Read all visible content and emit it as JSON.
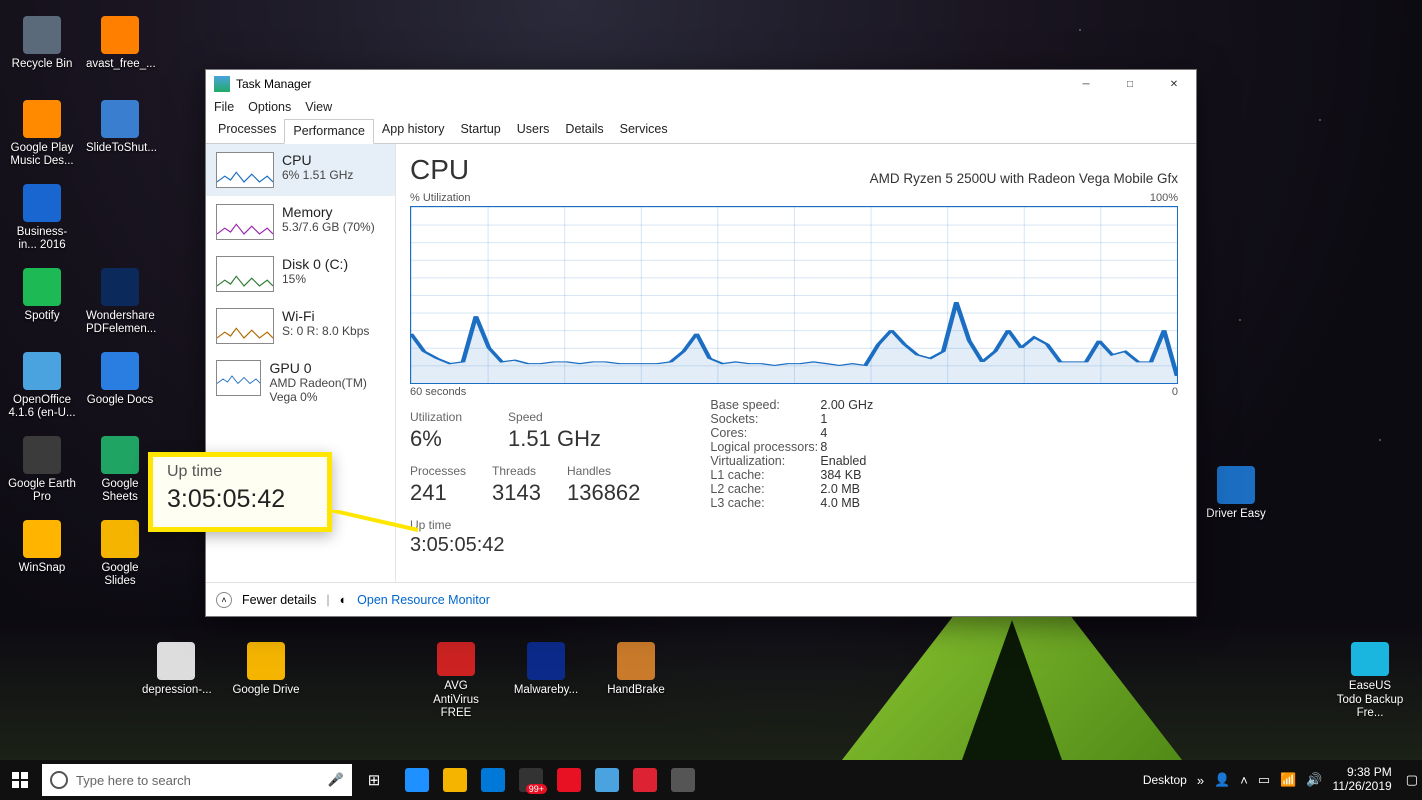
{
  "desktop": {
    "left_cols": [
      [
        {
          "label": "Recycle Bin",
          "color": "#5a6a7a"
        },
        {
          "label": "Google Play Music Des...",
          "color": "#ff8a00"
        },
        {
          "label": "Business-in... 2016",
          "color": "#1a66d0"
        },
        {
          "label": "Spotify",
          "color": "#1db954"
        },
        {
          "label": "OpenOffice 4.1.6 (en-U...",
          "color": "#4aa3df"
        },
        {
          "label": "Google Earth Pro",
          "color": "#3b3b3b"
        },
        {
          "label": "WinSnap",
          "color": "#ffb400"
        }
      ],
      [
        {
          "label": "avast_free_...",
          "color": "#ff7f00"
        },
        {
          "label": "SlideToShut...",
          "color": "#3a7ed0"
        },
        {
          "label": "",
          "color": "transparent"
        },
        {
          "label": "Wondershare PDFelemen...",
          "color": "#0b2a5b"
        },
        {
          "label": "Google Docs",
          "color": "#2a7de1"
        },
        {
          "label": "Google Sheets",
          "color": "#1fa463"
        },
        {
          "label": "Google Slides",
          "color": "#f4b400"
        }
      ]
    ],
    "right_single": {
      "label": "Driver Easy",
      "color": "#1b6ec2"
    },
    "bottom_left": [
      {
        "label": "depression-...",
        "color": "#dddddd"
      },
      {
        "label": "Google Drive",
        "color": "#f4b400"
      }
    ],
    "bottom_center": [
      {
        "label": "AVG AntiVirus FREE",
        "color": "#c22"
      },
      {
        "label": "Malwareby...",
        "color": "#0b2a8a"
      },
      {
        "label": "HandBrake",
        "color": "#c97a2a"
      }
    ],
    "bottom_right": {
      "label": "EaseUS Todo Backup Fre...",
      "color": "#1bb6e0"
    }
  },
  "window": {
    "title": "Task Manager",
    "menu": [
      "File",
      "Options",
      "View"
    ],
    "tabs": [
      "Processes",
      "Performance",
      "App history",
      "Startup",
      "Users",
      "Details",
      "Services"
    ],
    "active_tab": "Performance",
    "side": [
      {
        "name": "CPU",
        "sub": "6% 1.51 GHz",
        "selected": true,
        "color": "#1b6ec2"
      },
      {
        "name": "Memory",
        "sub": "5.3/7.6 GB (70%)",
        "selected": false,
        "color": "#9b27b0"
      },
      {
        "name": "Disk 0 (C:)",
        "sub": "15%",
        "selected": false,
        "color": "#2e7d32"
      },
      {
        "name": "Wi-Fi",
        "sub": "S: 0 R: 8.0 Kbps",
        "selected": false,
        "color": "#b26a00"
      },
      {
        "name": "GPU 0",
        "sub": "AMD Radeon(TM) Vega  0%",
        "selected": false,
        "color": "#1b6ec2"
      }
    ],
    "cpu": {
      "title": "CPU",
      "model": "AMD Ryzen 5 2500U with Radeon Vega Mobile Gfx",
      "top_left": "% Utilization",
      "top_right": "100%",
      "axis_left": "60 seconds",
      "axis_right": "0",
      "series": [
        28,
        18,
        14,
        11,
        12,
        38,
        20,
        12,
        13,
        11,
        11,
        12,
        12,
        11,
        12,
        12,
        11,
        11,
        11,
        11,
        12,
        18,
        28,
        14,
        11,
        12,
        11,
        11,
        10,
        11,
        11,
        12,
        11,
        10,
        11,
        10,
        22,
        30,
        22,
        16,
        14,
        18,
        46,
        24,
        12,
        18,
        30,
        20,
        26,
        22,
        12,
        12,
        12,
        24,
        16,
        18,
        12,
        12,
        30,
        4
      ],
      "stats": [
        {
          "label": "Utilization",
          "value": "6%"
        },
        {
          "label": "Speed",
          "value": "1.51 GHz"
        }
      ],
      "stats2": [
        {
          "label": "Processes",
          "value": "241"
        },
        {
          "label": "Threads",
          "value": "3143"
        },
        {
          "label": "Handles",
          "value": "136862"
        }
      ],
      "uptime_label": "Up time",
      "uptime_value": "3:05:05:42",
      "right_pairs": [
        {
          "k": "Base speed:",
          "v": "2.00 GHz"
        },
        {
          "k": "Sockets:",
          "v": "1"
        },
        {
          "k": "Cores:",
          "v": "4"
        },
        {
          "k": "Logical processors:",
          "v": "8"
        },
        {
          "k": "Virtualization:",
          "v": "Enabled"
        },
        {
          "k": "L1 cache:",
          "v": "384 KB"
        },
        {
          "k": "L2 cache:",
          "v": "2.0 MB"
        },
        {
          "k": "L3 cache:",
          "v": "4.0 MB"
        }
      ]
    },
    "footer": {
      "fewer": "Fewer details",
      "orm": "Open Resource Monitor"
    }
  },
  "callout": {
    "label": "Up time",
    "value": "3:05:05:42"
  },
  "taskbar": {
    "search_placeholder": "Type here to search",
    "desktop_label": "Desktop",
    "badge": "99+",
    "time": "9:38 PM",
    "date": "11/26/2019"
  },
  "chart_data": {
    "type": "line",
    "title": "CPU % Utilization",
    "xlabel": "seconds",
    "ylabel": "% Utilization",
    "x_range": [
      60,
      0
    ],
    "ylim": [
      0,
      100
    ],
    "x": [
      60,
      59,
      58,
      57,
      56,
      55,
      54,
      53,
      52,
      51,
      50,
      49,
      48,
      47,
      46,
      45,
      44,
      43,
      42,
      41,
      40,
      39,
      38,
      37,
      36,
      35,
      34,
      33,
      32,
      31,
      30,
      29,
      28,
      27,
      26,
      25,
      24,
      23,
      22,
      21,
      20,
      19,
      18,
      17,
      16,
      15,
      14,
      13,
      12,
      11,
      10,
      9,
      8,
      7,
      6,
      5,
      4,
      3,
      2,
      1
    ],
    "series": [
      {
        "name": "CPU",
        "values": [
          28,
          18,
          14,
          11,
          12,
          38,
          20,
          12,
          13,
          11,
          11,
          12,
          12,
          11,
          12,
          12,
          11,
          11,
          11,
          11,
          12,
          18,
          28,
          14,
          11,
          12,
          11,
          11,
          10,
          11,
          11,
          12,
          11,
          10,
          11,
          10,
          22,
          30,
          22,
          16,
          14,
          18,
          46,
          24,
          12,
          18,
          30,
          20,
          26,
          22,
          12,
          12,
          12,
          24,
          16,
          18,
          12,
          12,
          30,
          4
        ]
      }
    ]
  }
}
